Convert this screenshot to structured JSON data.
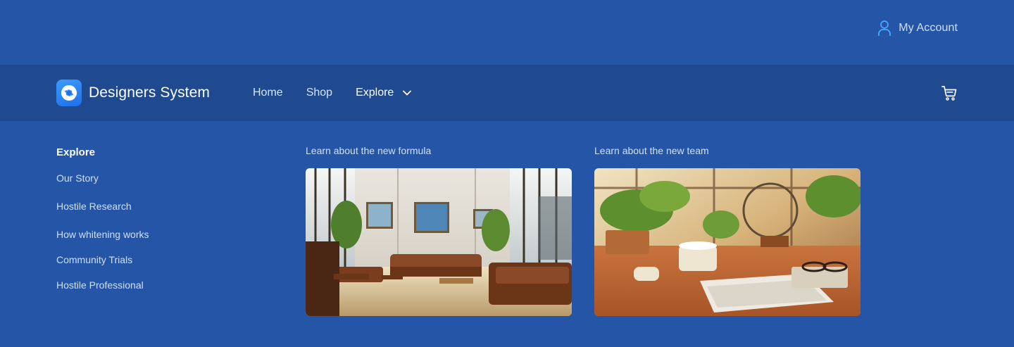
{
  "header": {
    "account_label": "My Account",
    "account_icon": "user-icon"
  },
  "nav": {
    "brand_name": "Designers System",
    "brand_icon": "aperture-logo-icon",
    "links": [
      {
        "label": "Home"
      },
      {
        "label": "Shop"
      },
      {
        "label": "Explore"
      }
    ],
    "cart_icon": "cart-icon"
  },
  "dropdown": {
    "title": "Explore",
    "items": [
      {
        "label": "Our Story"
      },
      {
        "label": "Hostile Research"
      },
      {
        "label": "How whitening works"
      },
      {
        "label": "Community Trials"
      },
      {
        "label": "Hostile Professional"
      }
    ],
    "features": [
      {
        "caption": "Learn about the new formula",
        "image": "office-lounge-photo"
      },
      {
        "caption": "Learn about the new team",
        "image": "sunlit-desk-plants-photo"
      }
    ]
  },
  "colors": {
    "background": "#2555a6",
    "navbar": "#1f4a8f",
    "accent": "#3d9bff",
    "muted_text": "#cfe0ff"
  }
}
